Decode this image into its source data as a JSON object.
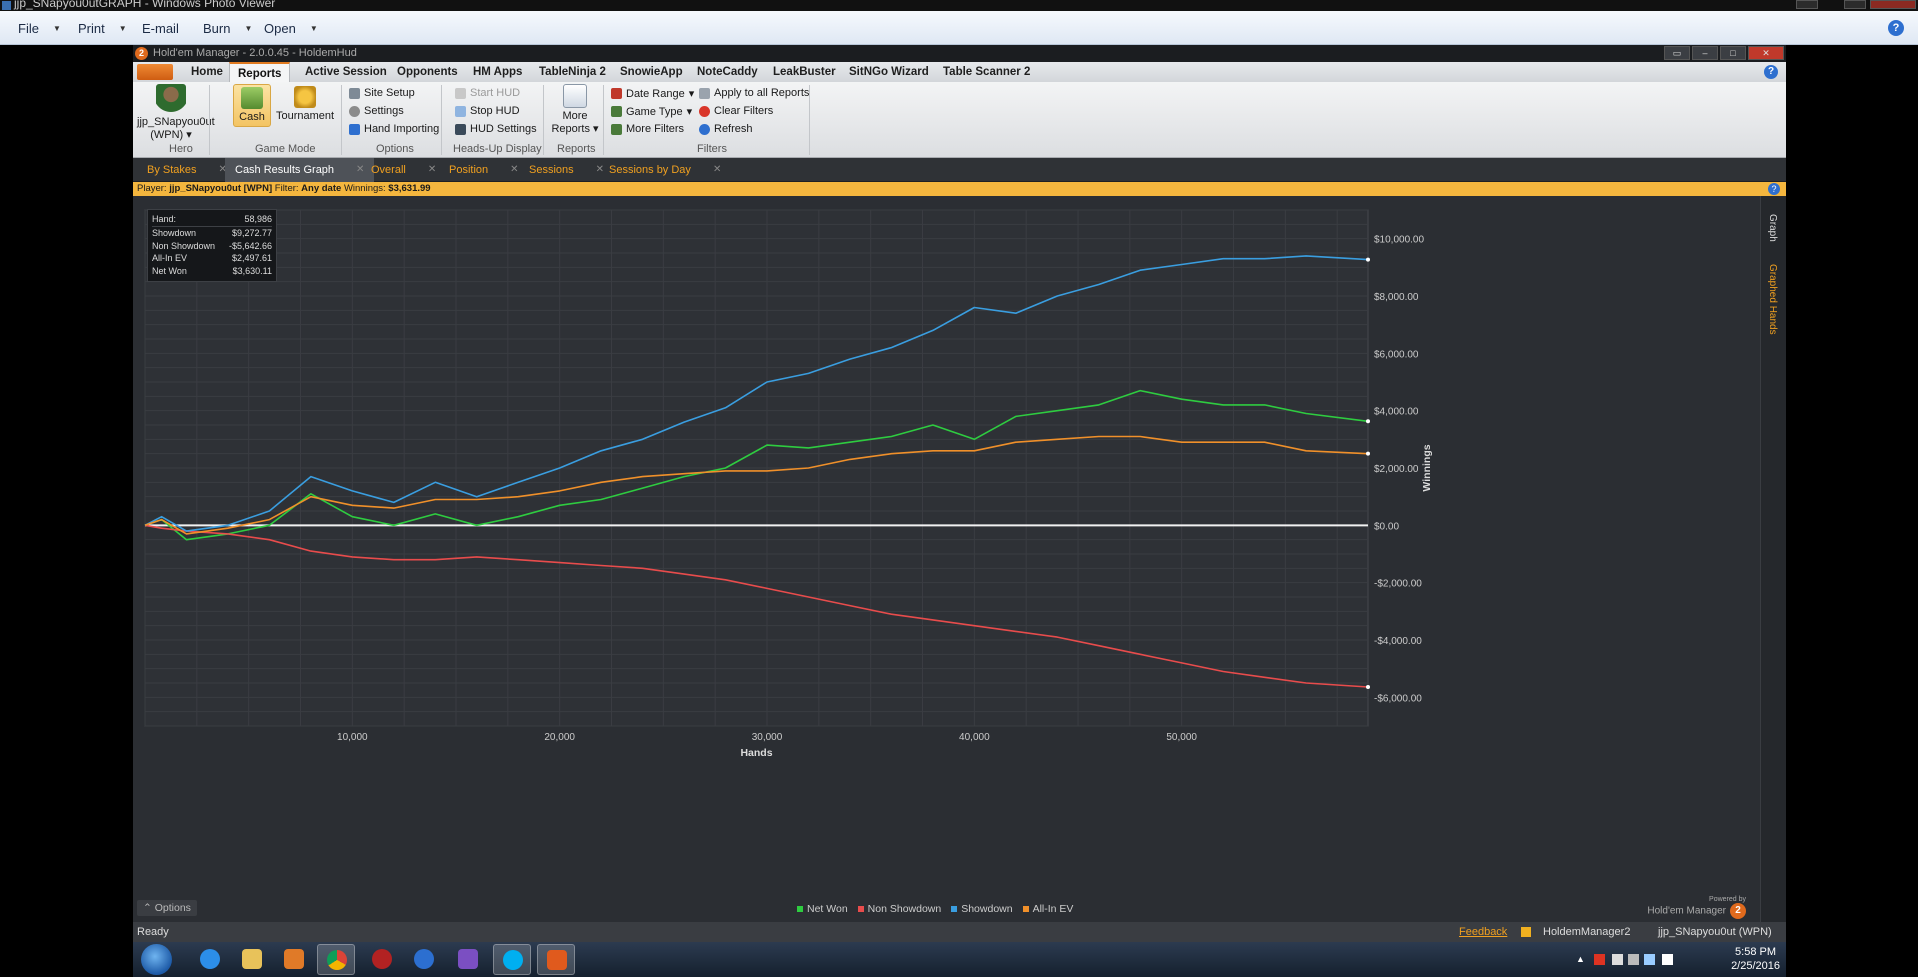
{
  "window": {
    "title": "jjp_SNapyou0utGRAPH - Windows Photo Viewer"
  },
  "photo_viewer_menu": [
    {
      "label": "File",
      "has_dropdown": true
    },
    {
      "label": "Print",
      "has_dropdown": true
    },
    {
      "label": "E-mail",
      "has_dropdown": false
    },
    {
      "label": "Burn",
      "has_dropdown": true
    },
    {
      "label": "Open",
      "has_dropdown": true
    }
  ],
  "hm": {
    "title": "Hold'em Manager - 2.0.0.45 - HoldemHud",
    "ribbon_tabs": [
      "Home",
      "Reports",
      "Active Session",
      "Opponents",
      "HM Apps",
      "TableNinja 2",
      "SnowieApp",
      "NoteCaddy",
      "LeakBuster",
      "SitNGo Wizard",
      "Table Scanner 2"
    ],
    "active_ribbon_tab": "Reports",
    "ribbon": {
      "hero": {
        "name": "jjp_SNapyou0ut",
        "site": "(WPN)",
        "group_label": "Hero"
      },
      "game_mode": {
        "cash": "Cash",
        "tournament": "Tournament",
        "group_label": "Game Mode"
      },
      "options": {
        "site_setup": "Site Setup",
        "settings": "Settings",
        "hand_importing": "Hand Importing",
        "group_label": "Options"
      },
      "hud": {
        "start": "Start HUD",
        "stop": "Stop HUD",
        "settings": "HUD Settings",
        "group_label": "Heads-Up Display"
      },
      "reports": {
        "more_line1": "More",
        "more_line2": "Reports",
        "group_label": "Reports"
      },
      "filters": {
        "date_range": "Date Range",
        "game_type": "Game Type",
        "more_filters": "More Filters",
        "apply_all": "Apply to all Reports",
        "clear": "Clear Filters",
        "refresh": "Refresh",
        "group_label": "Filters"
      }
    },
    "doc_tabs": [
      {
        "label": "By Stakes",
        "active": false
      },
      {
        "label": "Cash Results Graph",
        "active": true
      },
      {
        "label": "Overall",
        "active": false
      },
      {
        "label": "Position",
        "active": false
      },
      {
        "label": "Sessions",
        "active": false
      },
      {
        "label": "Sessions by Day",
        "active": false
      }
    ],
    "filterbar": {
      "player_label": "Player:",
      "player": "jjp_SNapyou0ut [WPN]",
      "filter_label": "Filter:",
      "filter": "Any date",
      "winnings_label": "Winnings:",
      "winnings": "$3,631.99"
    },
    "stats": [
      {
        "label": "Hand:",
        "value": "58,986"
      },
      {
        "label": "Showdown",
        "value": "$9,272.77"
      },
      {
        "label": "Non Showdown",
        "value": "-$5,642.66"
      },
      {
        "label": "All-In EV",
        "value": "$2,497.61"
      },
      {
        "label": "Net Won",
        "value": "$3,630.11"
      }
    ],
    "side_tabs": {
      "graph": "Graph",
      "graphed_hands": "Graphed Hands"
    },
    "options_button": "Options",
    "powered_by_line1": "Powered by",
    "powered_by_line2": "Hold'em Manager",
    "powered_by_logo": "2",
    "status": {
      "ready": "Ready",
      "feedback": "Feedback",
      "app": "HoldemManager2",
      "user": "jjp_SNapyou0ut (WPN)"
    }
  },
  "chart_data": {
    "type": "line",
    "xlabel": "Hands",
    "ylabel": "Winnings",
    "xlim": [
      0,
      58986
    ],
    "ylim": [
      -7000,
      11000
    ],
    "x_ticks": [
      10000,
      20000,
      30000,
      40000,
      50000
    ],
    "x_tick_labels": [
      "10,000",
      "20,000",
      "30,000",
      "40,000",
      "50,000"
    ],
    "y_ticks": [
      10000,
      8000,
      6000,
      4000,
      2000,
      0,
      -2000,
      -4000,
      -6000
    ],
    "y_tick_labels": [
      "$10,000.00",
      "$8,000.00",
      "$6,000.00",
      "$4,000.00",
      "$2,000.00",
      "$0.00",
      "-$2,000.00",
      "-$4,000.00",
      "-$6,000.00"
    ],
    "grid": true,
    "legend_position": "bottom",
    "x": [
      0,
      800,
      2000,
      4000,
      6000,
      8000,
      10000,
      12000,
      14000,
      16000,
      18000,
      20000,
      22000,
      24000,
      26000,
      28000,
      30000,
      32000,
      34000,
      36000,
      38000,
      40000,
      42000,
      44000,
      46000,
      48000,
      50000,
      52000,
      54000,
      56000,
      58986
    ],
    "series": [
      {
        "name": "Net Won",
        "color": "#2ecc40",
        "values": [
          0,
          200,
          -500,
          -300,
          0,
          1100,
          300,
          0,
          400,
          0,
          300,
          700,
          900,
          1300,
          1700,
          2000,
          2800,
          2700,
          2900,
          3100,
          3500,
          3000,
          3800,
          4000,
          4200,
          4700,
          4400,
          4200,
          4200,
          3900,
          3630
        ]
      },
      {
        "name": "Non Showdown",
        "color": "#e84c4c",
        "values": [
          0,
          -100,
          -200,
          -300,
          -500,
          -900,
          -1100,
          -1200,
          -1200,
          -1100,
          -1200,
          -1300,
          -1400,
          -1500,
          -1700,
          -1900,
          -2200,
          -2500,
          -2800,
          -3100,
          -3300,
          -3500,
          -3700,
          -3900,
          -4200,
          -4500,
          -4800,
          -5100,
          -5300,
          -5500,
          -5640
        ]
      },
      {
        "name": "Showdown",
        "color": "#3a9ee0",
        "values": [
          0,
          300,
          -200,
          0,
          500,
          1700,
          1200,
          800,
          1500,
          1000,
          1500,
          2000,
          2600,
          3000,
          3600,
          4100,
          5000,
          5300,
          5800,
          6200,
          6800,
          7600,
          7400,
          8000,
          8400,
          8900,
          9100,
          9300,
          9300,
          9400,
          9270
        ]
      },
      {
        "name": "All-In EV",
        "color": "#f0902a",
        "values": [
          0,
          200,
          -300,
          -100,
          200,
          1000,
          700,
          600,
          900,
          900,
          1000,
          1200,
          1500,
          1700,
          1800,
          1900,
          1900,
          2000,
          2300,
          2500,
          2600,
          2600,
          2900,
          3000,
          3100,
          3100,
          2900,
          2900,
          2900,
          2600,
          2500
        ]
      }
    ]
  },
  "taskbar": {
    "clock_time": "5:58 PM",
    "clock_date": "2/25/2016",
    "apps": [
      "Internet Explorer",
      "File Explorer",
      "Media Player",
      "Google Chrome",
      "App",
      "Hold'em Manager",
      "Visual Studio",
      "Skype",
      "Hold'em Manager 2"
    ]
  }
}
